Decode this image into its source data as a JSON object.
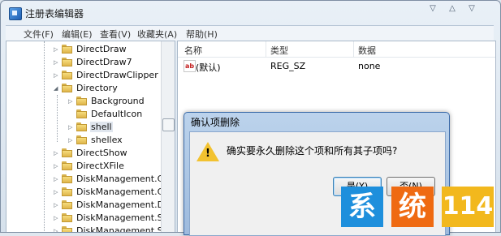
{
  "window": {
    "title": "注册表编辑器"
  },
  "menu": [
    "文件(F)",
    "编辑(E)",
    "查看(V)",
    "收藏夹(A)",
    "帮助(H)"
  ],
  "tree": [
    {
      "label": "DirectDraw",
      "expander": "▷"
    },
    {
      "label": "DirectDraw7",
      "expander": "▷"
    },
    {
      "label": "DirectDrawClipper",
      "expander": "▷"
    },
    {
      "label": "Directory",
      "expander": "◢"
    },
    {
      "label": "Background",
      "expander": "▷"
    },
    {
      "label": "DefaultIcon",
      "expander": ""
    },
    {
      "label": "shell",
      "expander": "▷"
    },
    {
      "label": "shellex",
      "expander": "▷"
    },
    {
      "label": "DirectShow",
      "expander": "▷"
    },
    {
      "label": "DirectXFile",
      "expander": "▷"
    },
    {
      "label": "DiskManagement.Cor",
      "expander": "▷"
    },
    {
      "label": "DiskManagement.Cor",
      "expander": "▷"
    },
    {
      "label": "DiskManagement.Dat",
      "expander": "▷"
    },
    {
      "label": "DiskManagement.Sna",
      "expander": "▷"
    },
    {
      "label": "DiskManagement.Sna",
      "expander": "▷"
    }
  ],
  "list": {
    "columns": [
      "名称",
      "类型",
      "数据"
    ],
    "rows": [
      {
        "icon": "ab",
        "name": "(默认)",
        "type": "REG_SZ",
        "data": "none"
      }
    ]
  },
  "dialog": {
    "title": "确认项删除",
    "message": "确实要永久删除这个项和所有其子项吗?",
    "yes_label": "是(Y)",
    "no_label": "否(N)"
  },
  "watermark": {
    "chars": [
      "系",
      "统",
      "114"
    ],
    "colors": [
      "#1e8fdc",
      "#ef6a12",
      "#f2b81d"
    ]
  }
}
